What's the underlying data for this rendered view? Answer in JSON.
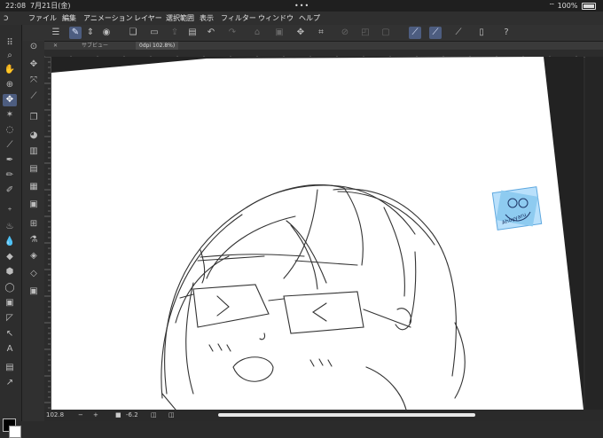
{
  "status_bar": {
    "time": "22:08",
    "date": "7月21日(金)",
    "dots": "•••",
    "battery": "100%"
  },
  "menu": {
    "items": [
      "ファイル",
      "編集",
      "アニメーション",
      "レイヤー",
      "選択範囲",
      "表示",
      "フィルター",
      "ウィンドウ",
      "ヘルプ"
    ]
  },
  "canvas_tabs": {
    "close": "✕",
    "sub_view": "サブビュー",
    "zoom_tab": "0dpi 102.8%)"
  },
  "bottom_bar": {
    "zoom_value": "102.8",
    "angle_value": "-6.2"
  },
  "colors": {
    "accent": "#4d5d80",
    "canvas_bg": "#ffffff",
    "sticker_blue": "#8ecbf0"
  },
  "sticker": {
    "text": "Ahoyyaru"
  }
}
